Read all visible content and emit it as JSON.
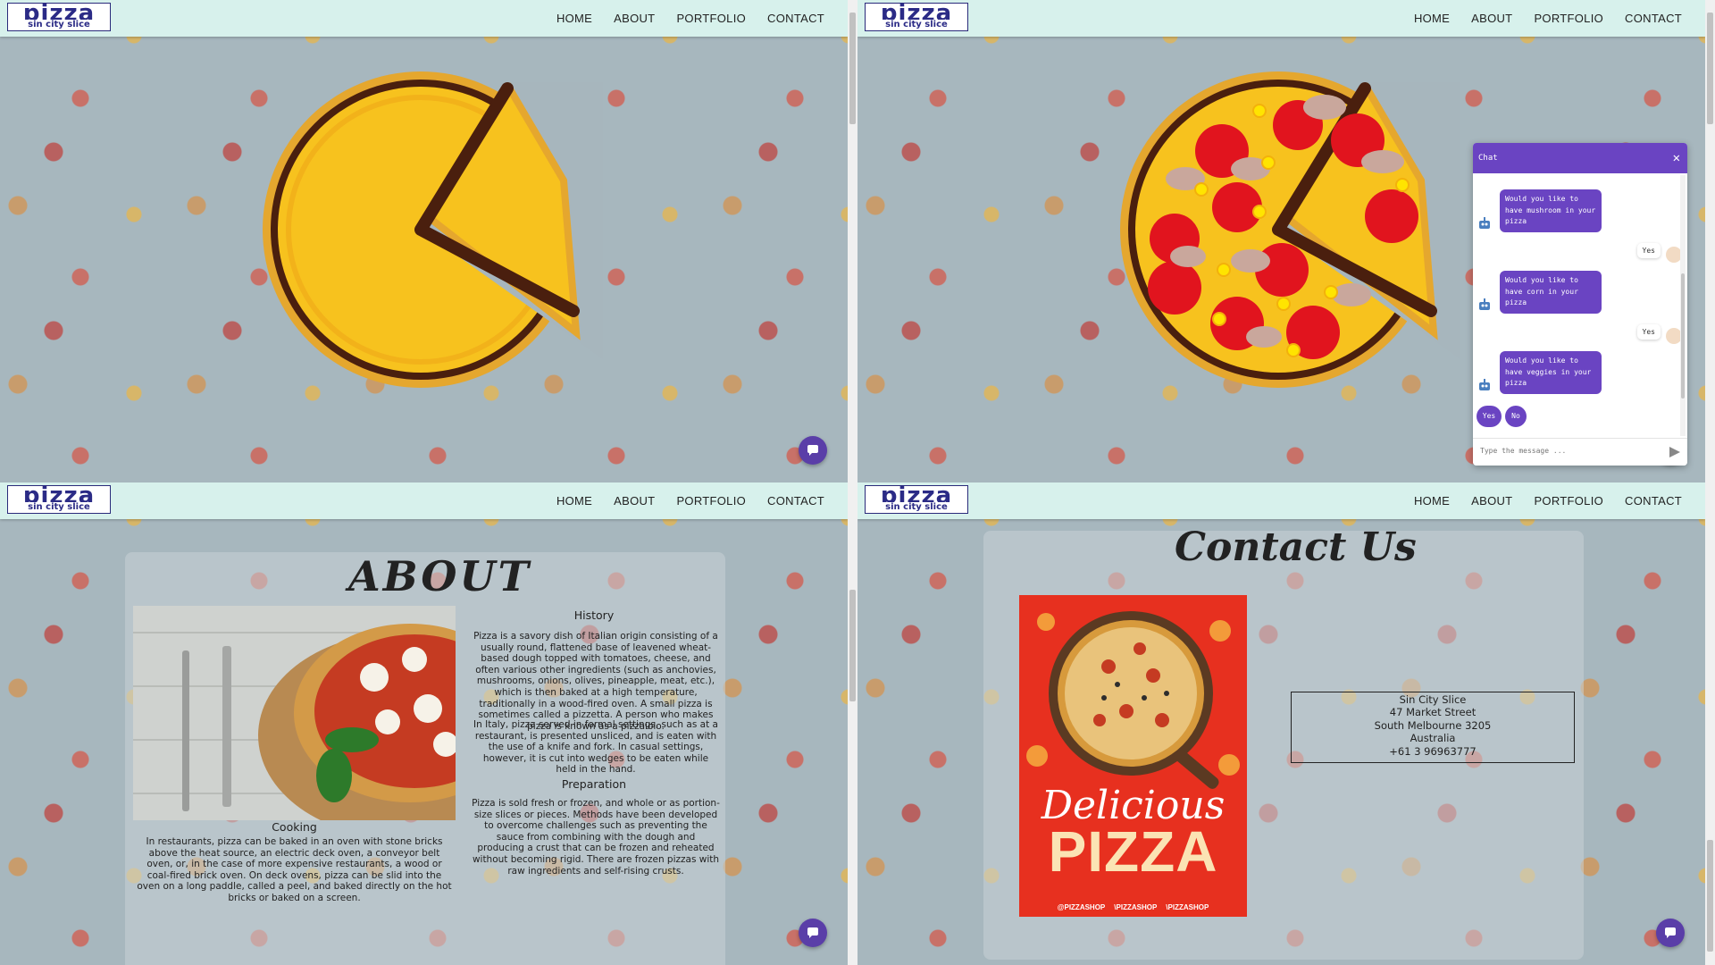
{
  "nav": {
    "logo_top": "pizza",
    "logo_bottom": "sin city slice",
    "items": [
      "HOME",
      "ABOUT",
      "PORTFOLIO",
      "CONTACT"
    ]
  },
  "chat": {
    "title": "Chat",
    "close": "✕",
    "messages": [
      {
        "from": "bot",
        "text": "Would you like to have mushroom in your pizza"
      },
      {
        "from": "user",
        "text": "Yes"
      },
      {
        "from": "bot",
        "text": "Would you like to have corn in your pizza"
      },
      {
        "from": "user",
        "text": "Yes"
      },
      {
        "from": "bot",
        "text": "Would you like to have veggies in your pizza"
      }
    ],
    "quick_replies": [
      "Yes",
      "No"
    ],
    "input_placeholder": "Type the message ..."
  },
  "about": {
    "title": "ABOUT",
    "history_heading": "History",
    "history_text": "Pizza is a savory dish of Italian origin consisting of a usually round, flattened base of leavened wheat-based dough topped with tomatoes, cheese, and often various other ingredients (such as anchovies, mushrooms, onions, olives, pineapple, meat, etc.), which is then baked at a high temperature, traditionally in a wood-fired oven. A small pizza is sometimes called a pizzetta. A person who makes pizza is known as a pizzaiolo.",
    "history_text_2": "In Italy, pizza served in formal settings, such as at a restaurant, is presented unsliced, and is eaten with the use of a knife and fork. In casual settings, however, it is cut into wedges to be eaten while held in the hand.",
    "preparation_heading": "Preparation",
    "preparation_text": "Pizza is sold fresh or frozen, and whole or as portion-size slices or pieces. Methods have been developed to overcome challenges such as preventing the sauce from combining with the dough and producing a crust that can be frozen and reheated without becoming rigid. There are frozen pizzas with raw ingredients and self-rising crusts.",
    "cooking_heading": "Cooking",
    "cooking_text": "In restaurants, pizza can be baked in an oven with stone bricks above the heat source, an electric deck oven, a conveyor belt oven, or, in the case of more expensive restaurants, a wood or coal-fired brick oven. On deck ovens, pizza can be slid into the oven on a long paddle, called a peel, and baked directly on the hot bricks or baked on a screen."
  },
  "contact": {
    "title": "Contact Us",
    "poster_script": "Delicious",
    "poster_big": "PIZZA",
    "poster_social": [
      "@PIZZASHOP",
      "\\PIZZASHOP",
      "\\PIZZASHOP"
    ],
    "address_lines": [
      "Sin City Slice",
      "47 Market Street",
      "South Melbourne 3205",
      "Australia",
      "+61 3 96963777"
    ]
  },
  "colors": {
    "nav_bg": "#d7f1ec",
    "accent_purple": "#6a44c2",
    "logo_blue": "#2b2b86",
    "pizza_yellow": "#f7c21e",
    "pizza_crust": "#e5a72e",
    "pizza_outline": "#4a1f0e",
    "pepperoni_red": "#e1141e"
  }
}
